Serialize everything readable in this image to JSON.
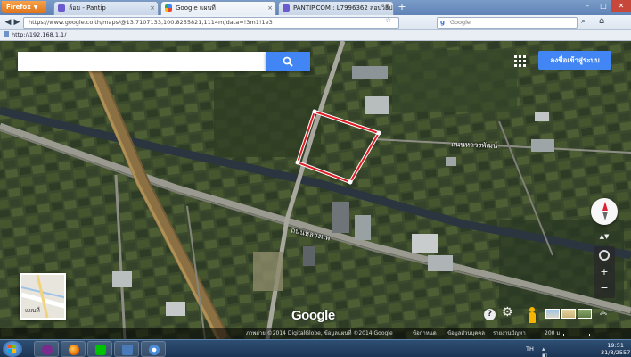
{
  "browser": {
    "menu_label": "Firefox",
    "tabs": [
      {
        "title": "ล้อม - Pantip",
        "active": false
      },
      {
        "title": "Google แผนที่",
        "active": true
      },
      {
        "title": "PANTIP.COM : L7996362 สอบวิธีปรับเส...",
        "active": false
      }
    ],
    "url": "https://www.google.co.th/maps/@13.7107133,100.8255821,1114m/data=!3m1!1e3",
    "search_placeholder": "Google",
    "bookmark": "http://192.168.1.1/"
  },
  "map": {
    "search_placeholder": "",
    "signin_label": "ลงชื่อเข้าสู่ระบบ",
    "road_label_1": "ถนนหลวงพัฒน์",
    "road_label_2": "ถนนหลวงแพ",
    "minimap_label": "แผนที่",
    "logo": "Google",
    "attribution": {
      "imagery": "ภาพถ่าย ©2014 DigitalGlobe, ข้อมูลแผนที่ ©2014 Google",
      "terms": "ข้อกำหนด",
      "privacy": "ข้อมูลส่วนบุคคล",
      "report": "รายงานปัญหา",
      "scale": "200 ม."
    },
    "colors": {
      "accent": "#4285f4",
      "highlight": "#e01b24"
    }
  },
  "taskbar": {
    "lang": "TH",
    "time": "19:51",
    "date": "31/3/2557",
    "apps": [
      "media-player",
      "firefox",
      "line",
      "network-app",
      "chrome-like"
    ]
  }
}
